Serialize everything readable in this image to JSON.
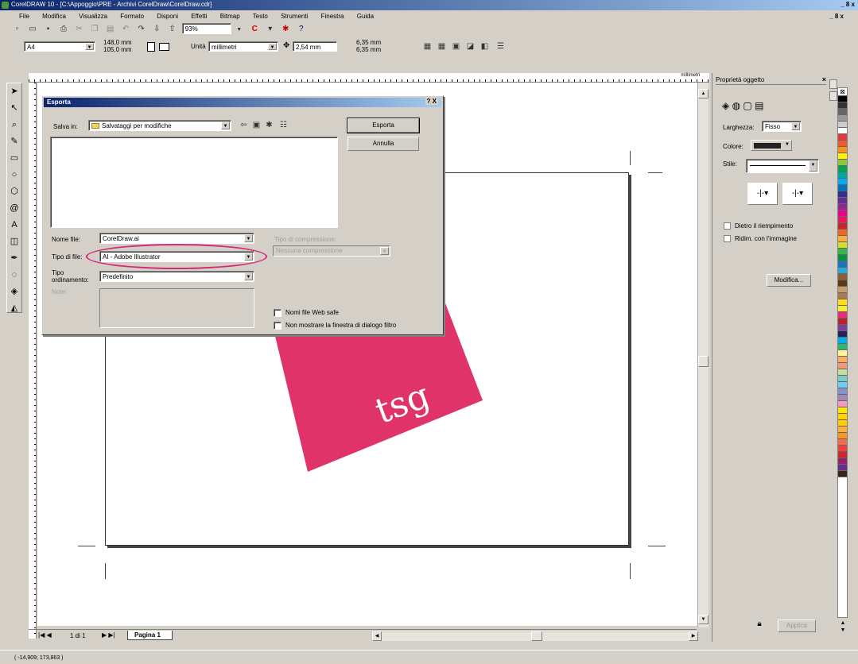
{
  "window": {
    "title": "CorelDRAW 10 - [C:\\Appoggio\\PRE - Archivi CorelDraw\\CorelDraw.cdr]",
    "controls": "_ 8 x"
  },
  "menu": [
    "File",
    "Modifica",
    "Visualizza",
    "Formato",
    "Disponi",
    "Effetti",
    "Bitmap",
    "Testo",
    "Strumenti",
    "Finestra",
    "Guida"
  ],
  "toolbar": {
    "zoom": "93%"
  },
  "propbar": {
    "preset": "A4",
    "width": "148,0 mm",
    "height": "105,0 mm",
    "units_label": "Unità",
    "units_value": "millimetri",
    "nudge": "2,54 mm",
    "dup_x": "6,35 mm",
    "dup_y": "6,35 mm"
  },
  "ruler": {
    "units": "millimetri"
  },
  "dialog": {
    "title": "Esporta",
    "help": "? X",
    "save_in_label": "Salva in:",
    "save_in_value": "Salvataggi per modifiche",
    "export_button": "Esporta",
    "cancel_button": "Annulla",
    "filename_label": "Nome file:",
    "filename_value": "CorelDraw.ai",
    "filetype_label": "Tipo di file:",
    "filetype_value": "AI - Adobe Illustrator",
    "sort_label": "Tipo ordinamento:",
    "sort_value": "Predefinito",
    "notes_label": "Note:",
    "compression_label": "Tipo di compressione:",
    "compression_value": "Nessuna compressione",
    "websafe_label": "Nomi file Web safe",
    "nofilter_label": "Non mostrare la finestra di dialogo filtro"
  },
  "artwork": {
    "logo_text": "tsg",
    "color": "#e0336a"
  },
  "docker": {
    "title": "Proprietà oggetto",
    "width_label": "Larghezza:",
    "width_value": "Fisso",
    "color_label": "Colore:",
    "style_label": "Stile:",
    "behind_fill": "Dietro il riempimento",
    "scale_image": "Ridim. con l'immagine",
    "edit_button": "Modifica...",
    "apply_button": "Applica"
  },
  "pagetabs": {
    "nav": "1 di 1",
    "page": "Pagina 1"
  },
  "statusbar": {
    "coords": "( -14,909; 173,863 )"
  },
  "palette": [
    "#000000",
    "#333333",
    "#666666",
    "#999999",
    "#cccccc",
    "#ffffff",
    "#e03a3a",
    "#f05a28",
    "#f7941d",
    "#fff200",
    "#8dc63f",
    "#00a651",
    "#00a99d",
    "#00aeef",
    "#0072bc",
    "#2e3192",
    "#662d91",
    "#92278f",
    "#ec008c",
    "#ed145b",
    "#c1272d",
    "#f26522",
    "#fbb040",
    "#d7df23",
    "#39b54a",
    "#009444",
    "#1b75bc",
    "#27aae1",
    "#8b5e3c",
    "#603913",
    "#c69c6d",
    "#a67c52",
    "#ffde17",
    "#f9ed32",
    "#ee2a7b",
    "#be1e2d",
    "#7f3f98",
    "#262262",
    "#00aeef",
    "#2bb673",
    "#fff799",
    "#fbaf5d",
    "#f7977a",
    "#c4df9b",
    "#7accc8",
    "#6dcff6",
    "#8393ca",
    "#a186be",
    "#f49ac1",
    "#ffe600",
    "#ffd200",
    "#ffcb05",
    "#fcb040",
    "#f8981d",
    "#f26c4f",
    "#ef4136",
    "#d2232a",
    "#9e1f63",
    "#662d91",
    "#3c2415"
  ]
}
